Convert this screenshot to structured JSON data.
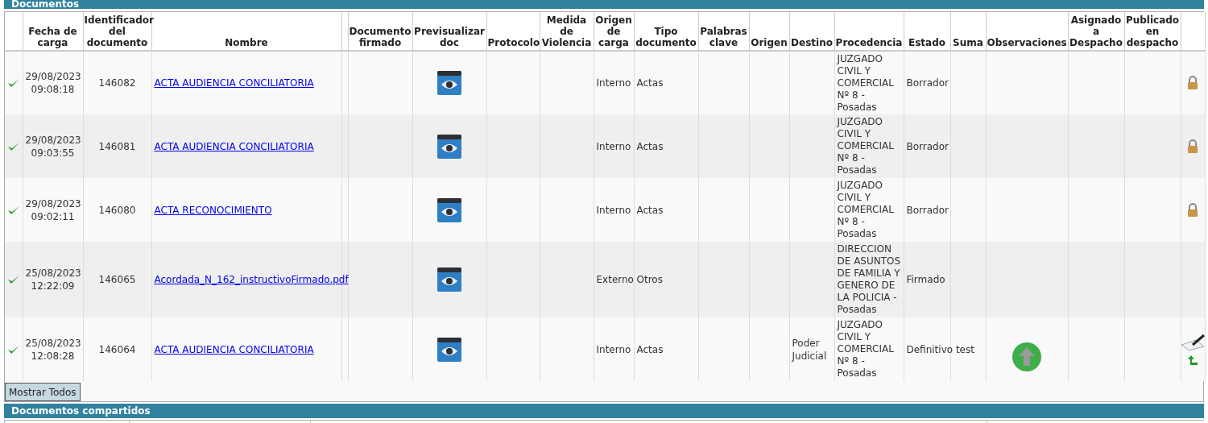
{
  "section_title": "Documentos",
  "columns": [
    "",
    "Fecha de carga",
    "Identificador del documento",
    "Nombre",
    "",
    "Documento firmado",
    "Previsualizar doc",
    "Protocolo",
    "Medida de Violencia",
    "Origen de carga",
    "Tipo documento",
    "Palabras clave",
    "Origen",
    "Destino",
    "Procedencia",
    "Estado",
    "Suma",
    "Observaciones",
    "Asignado a Despacho",
    "Publicado en despacho",
    ""
  ],
  "rows": [
    {
      "verified": true,
      "fecha": "29/08/2023",
      "hora": "09:08:18",
      "id": "146082",
      "nombre": "ACTA AUDIENCIA CONCILIATORIA",
      "origen_carga": "Interno",
      "tipo": "Actas",
      "destino": "",
      "procedencia": "JUZGADO CIVIL Y COMERCIAL Nº 8 - Posadas",
      "estado": "Borrador",
      "upload_action": false,
      "kind": "locked"
    },
    {
      "verified": true,
      "fecha": "29/08/2023",
      "hora": "09:03:55",
      "id": "146081",
      "nombre": "ACTA AUDIENCIA CONCILIATORIA",
      "origen_carga": "Interno",
      "tipo": "Actas",
      "destino": "",
      "procedencia": "JUZGADO CIVIL Y COMERCIAL Nº 8 - Posadas",
      "estado": "Borrador",
      "upload_action": false,
      "kind": "locked"
    },
    {
      "verified": true,
      "fecha": "29/08/2023",
      "hora": "09:02:11",
      "id": "146080",
      "nombre": "ACTA RECONOCIMIENTO",
      "origen_carga": "Interno",
      "tipo": "Actas",
      "destino": "",
      "procedencia": "JUZGADO CIVIL Y COMERCIAL Nº 8 - Posadas",
      "estado": "Borrador",
      "upload_action": false,
      "kind": "locked"
    },
    {
      "verified": true,
      "fecha": "25/08/2023",
      "hora": "12:22:09",
      "id": "146065",
      "nombre": "Acordada_N_162_instructivoFirmado.pdf",
      "origen_carga": "Externo",
      "tipo": "Otros",
      "destino": "",
      "procedencia": "DIRECCION DE ASUNTOS DE FAMILIA Y GENERO DE LA POLICIA - Posadas",
      "estado": "Firmado",
      "upload_action": false,
      "kind": "none"
    },
    {
      "verified": true,
      "fecha": "25/08/2023",
      "hora": "12:08:28",
      "id": "146064",
      "nombre": "ACTA AUDIENCIA CONCILIATORIA",
      "origen_carga": "Interno",
      "tipo": "Actas",
      "destino": "Poder Judicial",
      "procedencia": "JUZGADO CIVIL Y COMERCIAL Nº 8 - Posadas",
      "estado": "Definitivo test",
      "upload_action": true,
      "kind": "sign"
    }
  ],
  "show_all_button": "Mostrar Todos",
  "shared_title": "Documentos compartidos"
}
